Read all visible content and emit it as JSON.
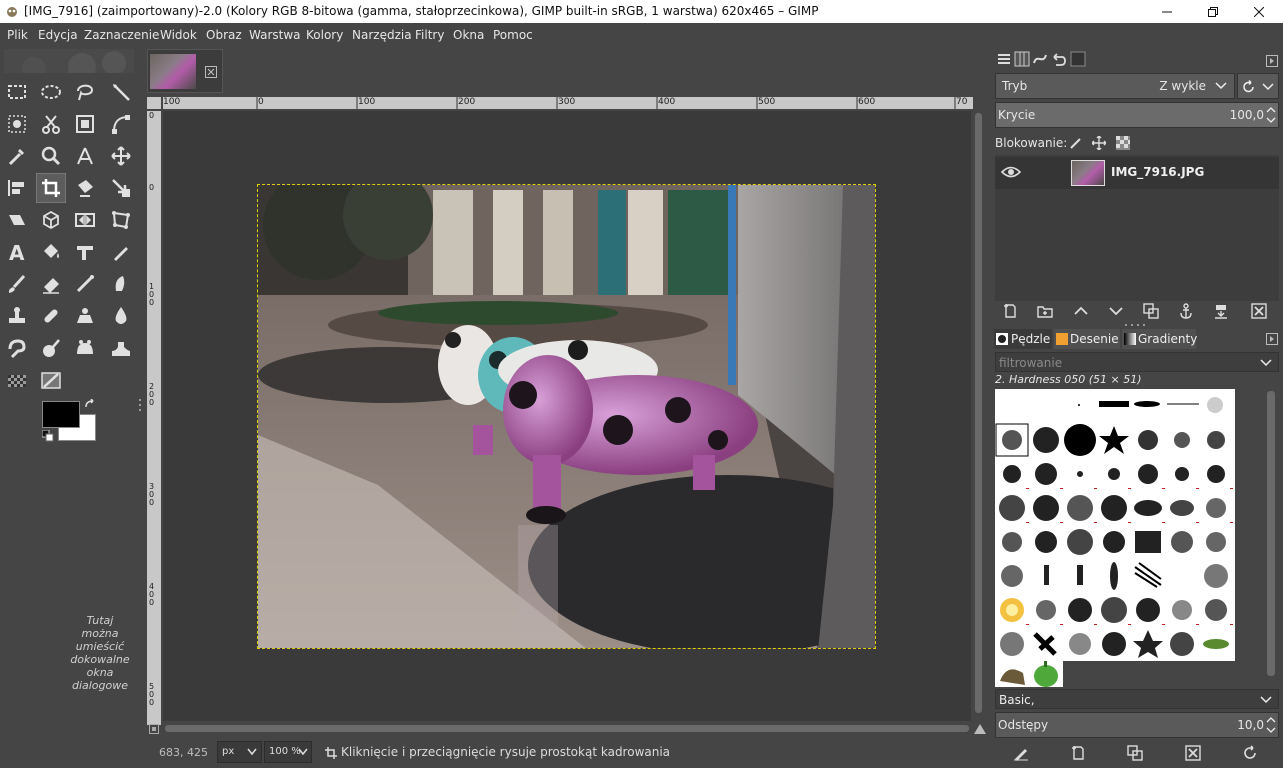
{
  "window": {
    "title": "[IMG_7916] (zaimportowany)-2.0 (Kolory RGB 8-bitowa (gamma, stałoprzecinkowa), GIMP built-in sRGB, 1 warstwa) 620x465 – GIMP"
  },
  "menu": [
    "Plik",
    "Edycja",
    "Zaznaczenie",
    "Widok",
    "Obraz",
    "Warstwa",
    "Kolory",
    "Narzędzia",
    "Filtry",
    "Okna",
    "Pomoc"
  ],
  "toolbox": {
    "tools": [
      "rect-select",
      "ellipse-select",
      "free-select",
      "fuzzy-select",
      "foreground-select",
      "scissors-select",
      "by-color-select",
      "paths",
      "color-picker",
      "zoom",
      "measure",
      "move",
      "align",
      "crop",
      "unified-transform",
      "flip",
      "shear",
      "perspective",
      "handle-transform",
      "cage",
      "text",
      "bucket-fill",
      "warp",
      "ink",
      "paintbrush",
      "eraser",
      "airbrush",
      "smudge",
      "clone",
      "heal",
      "perspective-clone",
      "dodge-burn",
      "blur",
      "mypaint-brush",
      "gegl-op",
      "ink-stroke",
      "pattern",
      "gradient"
    ],
    "fg_color": "#000000",
    "bg_color": "#ffffff",
    "dock_hint": [
      "Tutaj",
      "można",
      "umieścić",
      "dokowalne",
      "okna",
      "dialogowe"
    ]
  },
  "rulers": {
    "h_labels": [
      "100",
      "0",
      "100",
      "200",
      "300",
      "400",
      "500",
      "600",
      "70"
    ],
    "v_labels": [
      "0",
      "0",
      "100",
      "200",
      "300",
      "400",
      "500"
    ]
  },
  "status": {
    "coords": "683, 425",
    "unit": "px",
    "zoom": "100 %",
    "message": "Kliknięcie i przeciągnięcie rysuje prostokąt kadrowania"
  },
  "layers": {
    "mode_label": "Tryb",
    "mode_value": "Z wykle",
    "opacity_label": "Krycie",
    "opacity_value": "100,0",
    "lock_label": "Blokowanie:",
    "layer_name": "IMG_7916.JPG"
  },
  "brushes": {
    "tabs": [
      "Pędzle",
      "Desenie",
      "Gradienty"
    ],
    "filter_placeholder": "filtrowanie",
    "selected": "2. Hardness 050 (51 × 51)",
    "preset": "Basic,",
    "spacing_label": "Odstępy",
    "spacing_value": "10,0"
  }
}
